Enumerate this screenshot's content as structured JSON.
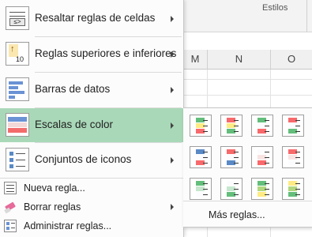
{
  "ribbon": {
    "group_label": "Estilos"
  },
  "columns": [
    "M",
    "N",
    "O"
  ],
  "menu": {
    "items": [
      {
        "label": "Resaltar reglas de celdas",
        "icon": "highlight-cells-icon",
        "has_submenu": true,
        "active": false
      },
      {
        "label": "Reglas superiores e inferiores",
        "icon": "top-bottom-rules-icon",
        "has_submenu": true,
        "active": false
      },
      {
        "label": "Barras de datos",
        "icon": "data-bars-icon",
        "has_submenu": true,
        "active": false
      },
      {
        "label": "Escalas de color",
        "icon": "color-scales-icon",
        "has_submenu": true,
        "active": true
      },
      {
        "label": "Conjuntos de iconos",
        "icon": "icon-sets-icon",
        "has_submenu": true,
        "active": false
      }
    ],
    "small_items": [
      {
        "label": "Nueva regla...",
        "icon": "new-rule-icon",
        "has_submenu": false
      },
      {
        "label": "Borrar reglas",
        "icon": "eraser-icon",
        "has_submenu": true
      },
      {
        "label": "Administrar reglas...",
        "icon": "manage-rules-icon",
        "has_submenu": false
      }
    ]
  },
  "submenu": {
    "more_label": "Más reglas...",
    "scales": [
      [
        "#63be7b",
        "#ffeb84",
        "#f8696b"
      ],
      [
        "#f8696b",
        "#ffeb84",
        "#63be7b"
      ],
      [
        "#63be7b",
        "#fcfcff",
        "#f8696b"
      ],
      [
        "#f8696b",
        "#fcfcff",
        "#63be7b"
      ],
      [
        "#5a8ac6",
        "#fcfcff",
        "#f8696b"
      ],
      [
        "#f8696b",
        "#fcfcff",
        "#5a8ac6"
      ],
      [
        "#fcfcff",
        "#f8e3e3",
        "#f8696b"
      ],
      [
        "#f8696b",
        "#f8e3e3",
        "#fcfcff"
      ],
      [
        "#63be7b",
        "#c6e6ce",
        "#fcfcff"
      ],
      [
        "#fcfcff",
        "#c6e6ce",
        "#63be7b"
      ],
      [
        "#63be7b",
        "#b0d77f",
        "#ffeb84"
      ],
      [
        "#ffeb84",
        "#b0d77f",
        "#63be7b"
      ]
    ]
  }
}
